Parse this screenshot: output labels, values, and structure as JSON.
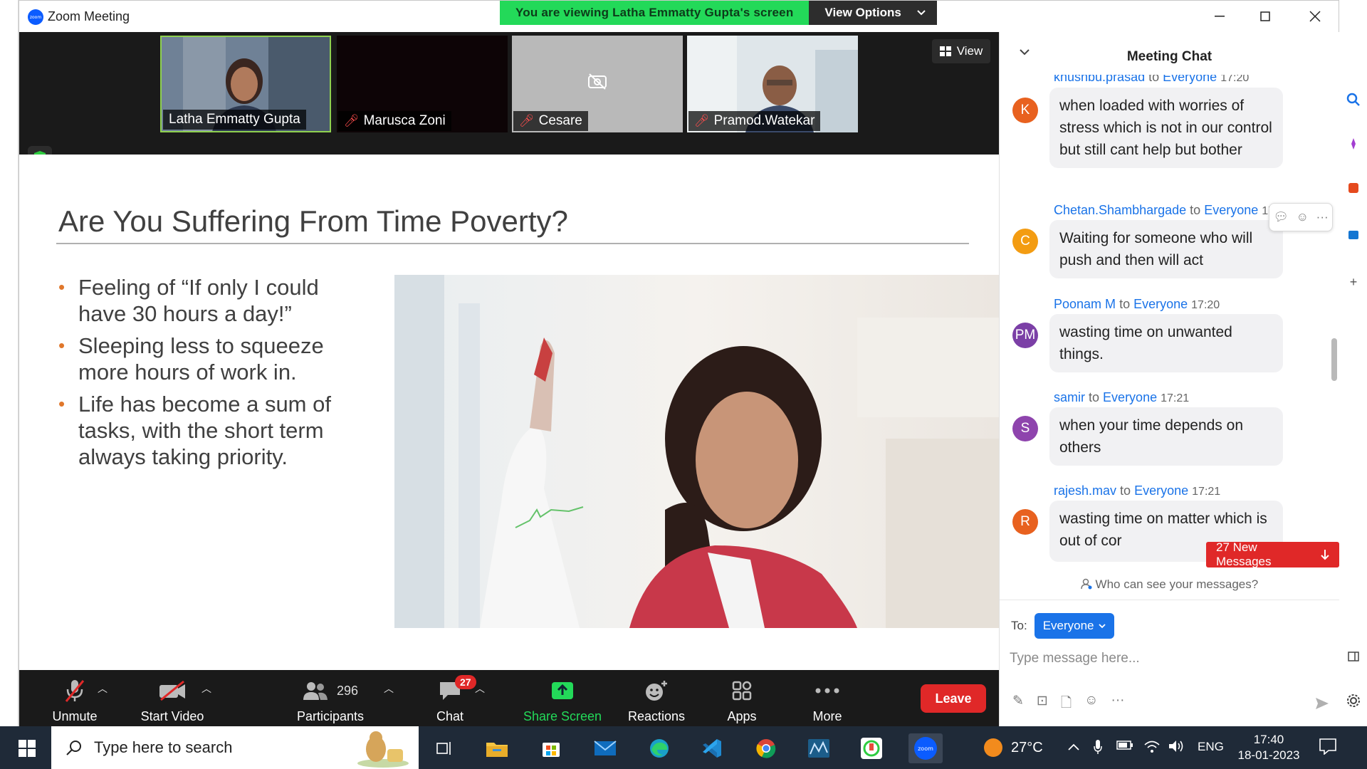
{
  "window": {
    "app_title": "Zoom Meeting",
    "logo_text": "zoom",
    "banner_text": "You are viewing Latha Emmatty Gupta's screen",
    "view_options_label": "View Options"
  },
  "video": {
    "view_label": "View",
    "participants": [
      {
        "name": "Latha Emmatty Gupta",
        "muted": false
      },
      {
        "name": "Marusca Zoni",
        "muted": true
      },
      {
        "name": "Cesare",
        "muted": true
      },
      {
        "name": "Pramod.Watekar",
        "muted": true
      }
    ]
  },
  "slide": {
    "title": "Are You Suffering From Time Poverty?",
    "bullets": [
      "Feeling of “If only I could have 30 hours a day!”",
      "Sleeping less to squeeze more hours of work in.",
      "Life has become a sum of tasks, with the short term always taking priority."
    ]
  },
  "toolbar": {
    "unmute": "Unmute",
    "start_video": "Start Video",
    "participants_label": "Participants",
    "participants_count": "296",
    "chat_label": "Chat",
    "chat_count": "27",
    "share_screen": "Share Screen",
    "reactions": "Reactions",
    "apps": "Apps",
    "more": "More",
    "leave": "Leave"
  },
  "chat": {
    "title": "Meeting Chat",
    "to_word": "to",
    "messages": [
      {
        "initials": "K",
        "color": "#e8611f",
        "sender": "khushbu.prasad",
        "to": "Everyone",
        "time": "17:20",
        "text": "when loaded with worries of stress which is not in our control but still cant help but bother"
      },
      {
        "initials": "C",
        "color": "#f39c12",
        "sender": "Chetan.Shambhargade",
        "to": "Everyone",
        "time": "17:20",
        "text": "Waiting for someone who will push and then will act"
      },
      {
        "initials": "PM",
        "color": "#7b3fa6",
        "sender": "Poonam M",
        "to": "Everyone",
        "time": "17:20",
        "text": "wasting  time on unwanted things."
      },
      {
        "initials": "S",
        "color": "#8e44ad",
        "sender": "samir",
        "to": "Everyone",
        "time": "17:21",
        "text": "when your time depends on others"
      },
      {
        "initials": "R",
        "color": "#e8611f",
        "sender": "rajesh.mav",
        "to": "Everyone",
        "time": "17:21",
        "text": "wasting time on matter which is out of cor"
      }
    ],
    "new_messages": "27 New Messages",
    "who_can_see": "Who can see your messages?",
    "to_label": "To:",
    "to_value": "Everyone",
    "input_placeholder": "Type message here..."
  },
  "taskbar": {
    "search_placeholder": "Type here to search",
    "temperature": "27°C",
    "language": "ENG",
    "time": "17:40",
    "date": "18-01-2023"
  },
  "colors": {
    "zoom_blue": "#0b5cff",
    "banner_green": "#23d959",
    "leave_red": "#e02828",
    "share_green": "#23d959",
    "link_blue": "#1a73e8",
    "bullet_orange": "#e0772b"
  }
}
